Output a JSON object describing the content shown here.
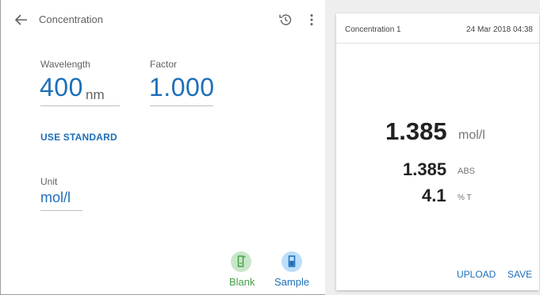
{
  "topbar": {
    "title": "Concentration",
    "back_icon": "arrow-back-icon",
    "history_icon": "history-icon",
    "more_icon": "more-vert-icon"
  },
  "wavelength": {
    "label": "Wavelength",
    "value": "400",
    "unit": "nm"
  },
  "factor": {
    "label": "Factor",
    "value": "1.000"
  },
  "use_standard_label": "USE STANDARD",
  "unit_field": {
    "label": "Unit",
    "value": "mol/l"
  },
  "actions": {
    "blank": {
      "label": "Blank",
      "icon": "blank-cuvette-icon",
      "color": "#43a047",
      "bg": "#c8e6c9"
    },
    "sample": {
      "label": "Sample",
      "icon": "sample-cuvette-icon",
      "color": "#1e6fb8",
      "bg": "#bbdefb"
    }
  },
  "result_card": {
    "title": "Concentration 1",
    "date": "24 Mar 2018 04:38",
    "concentration_value": "1.385",
    "concentration_unit": "mol/l",
    "abs_value": "1.385",
    "abs_unit": "ABS",
    "transmittance_value": "4.1",
    "transmittance_unit": "% T",
    "upload_label": "UPLOAD",
    "save_label": "SAVE"
  },
  "colors": {
    "accent": "#1e6fb8",
    "green": "#43a047"
  }
}
